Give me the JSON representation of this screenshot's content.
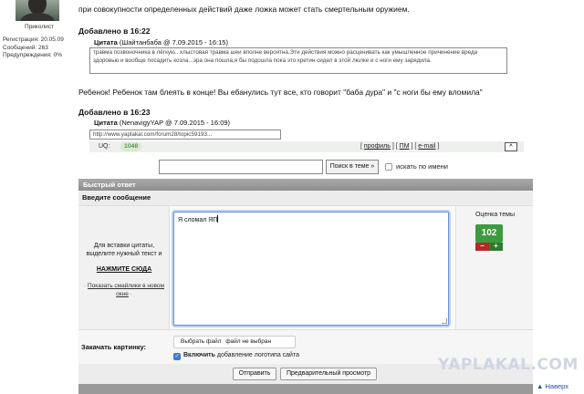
{
  "user": {
    "rank": "Приколист",
    "registration": "Регистрация: 20.05.09",
    "messages": "Сообщений: 263",
    "warnings": "Предупреждения: 0%"
  },
  "posts": {
    "intro_line": "при совокупности определенных действий даже ложка может стать смертельным оружием.",
    "added1": "Добавлено в 16:22",
    "quote1_author": "Цитата",
    "quote1_meta": "(Шайтанбаба @ 7.09.2015 - 16:15)",
    "quote1_text": "травма позвоночника в лёгкую.. хлыстовая травма шеи вполне вероятна.Эти действия можно расценивать как умышленное причинение вреда здоровью и вообще посадить козла...эра она пошла,я бы подошла пока это кретин сидел в этой люлке и с ноги ему зарядила.",
    "reply1": "Ребенок! Ребенок там блеять в конце! Вы ебанулись тут все, кто говорит \"баба дура\" и \"с ноги бы ему вломила\"",
    "added2": "Добавлено в 16:23",
    "quote2_author": "Цитата",
    "quote2_meta": "(NenavigyYAP @ 7.09.2015 - 16:09)",
    "quote2_text": "http://www.yaplakal.com/forum28/topic59193..."
  },
  "footer": {
    "uq_label": "UQ:",
    "uq_value": "1048",
    "profile": "профиль",
    "pm": "ПМ",
    "email": "e-mail",
    "sep_open": "[",
    "sep_close": "]",
    "up": "^"
  },
  "search": {
    "button": "Поиск в теме »",
    "name_label": "искать по имени"
  },
  "quick_reply": {
    "header": "Быстрый ответ",
    "enter_message": "Введите сообщение",
    "hint": "Для вставки цитаты, выделите нужный текст и",
    "click_here": "НАЖМИТЕ СЮДА",
    "smiles_bullet": "·",
    "smiles_link": "Показать смайлики в новом окне",
    "smiles_end": "·",
    "message_text": "Я сломал ЯП",
    "rating_label": "Оценка темы",
    "rating_value": "102",
    "rate_minus": "−",
    "rate_plus": "+",
    "upload_label": "Закачать картинку:",
    "file_button": "Выбрать файл",
    "file_status": "файл не выбран",
    "logo_check": "✓",
    "logo_enable": "Включить",
    "logo_rest": "добавление логотипа сайта",
    "send": "Отправить",
    "preview": "Предварительный просмотр"
  },
  "watermark": "YAPLAKAL.COM",
  "back_link": "▲ Наверх",
  "colors": {
    "rating_green": "#3e9a3e",
    "header_gray": "#9a9a9a",
    "focus_blue": "#6e8fc9"
  }
}
